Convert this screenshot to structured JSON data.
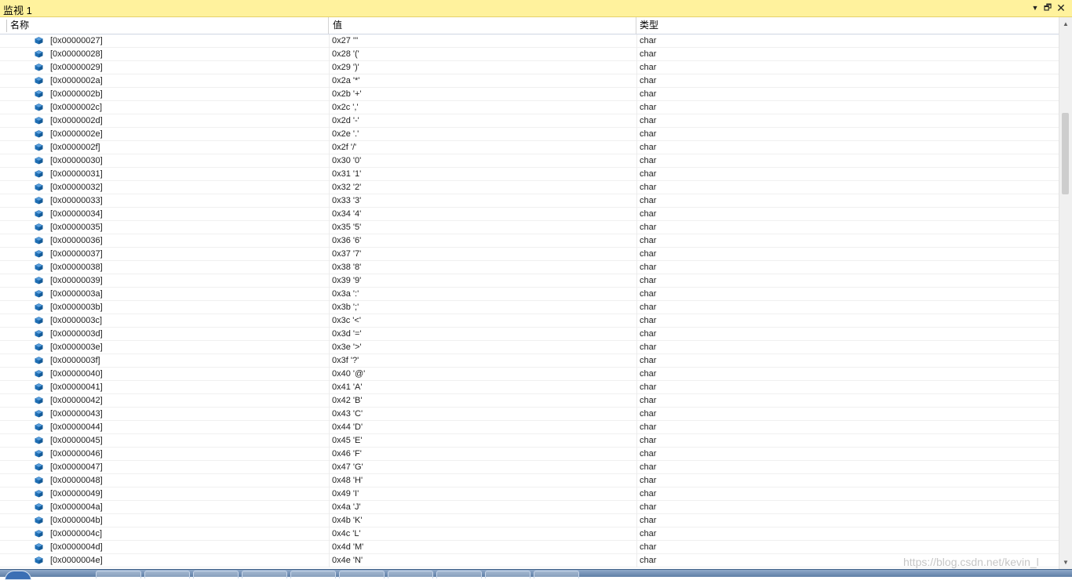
{
  "window": {
    "title": "监视 1",
    "dropdown_icon": "triangle-down-icon",
    "restore_icon": "restore-icon",
    "close_icon": "close-icon"
  },
  "header": {
    "col_name": "名称",
    "col_value": "值",
    "col_type": "类型"
  },
  "icon_color": "#1f6fb5",
  "rows": [
    {
      "name": "[0x00000027]",
      "value": "0x27 '''",
      "type": "char"
    },
    {
      "name": "[0x00000028]",
      "value": "0x28 '('",
      "type": "char"
    },
    {
      "name": "[0x00000029]",
      "value": "0x29 ')'",
      "type": "char"
    },
    {
      "name": "[0x0000002a]",
      "value": "0x2a '*'",
      "type": "char"
    },
    {
      "name": "[0x0000002b]",
      "value": "0x2b '+'",
      "type": "char"
    },
    {
      "name": "[0x0000002c]",
      "value": "0x2c ','",
      "type": "char"
    },
    {
      "name": "[0x0000002d]",
      "value": "0x2d '-'",
      "type": "char"
    },
    {
      "name": "[0x0000002e]",
      "value": "0x2e '.'",
      "type": "char"
    },
    {
      "name": "[0x0000002f]",
      "value": "0x2f '/'",
      "type": "char"
    },
    {
      "name": "[0x00000030]",
      "value": "0x30 '0'",
      "type": "char"
    },
    {
      "name": "[0x00000031]",
      "value": "0x31 '1'",
      "type": "char"
    },
    {
      "name": "[0x00000032]",
      "value": "0x32 '2'",
      "type": "char"
    },
    {
      "name": "[0x00000033]",
      "value": "0x33 '3'",
      "type": "char"
    },
    {
      "name": "[0x00000034]",
      "value": "0x34 '4'",
      "type": "char"
    },
    {
      "name": "[0x00000035]",
      "value": "0x35 '5'",
      "type": "char"
    },
    {
      "name": "[0x00000036]",
      "value": "0x36 '6'",
      "type": "char"
    },
    {
      "name": "[0x00000037]",
      "value": "0x37 '7'",
      "type": "char"
    },
    {
      "name": "[0x00000038]",
      "value": "0x38 '8'",
      "type": "char"
    },
    {
      "name": "[0x00000039]",
      "value": "0x39 '9'",
      "type": "char"
    },
    {
      "name": "[0x0000003a]",
      "value": "0x3a ':'",
      "type": "char"
    },
    {
      "name": "[0x0000003b]",
      "value": "0x3b ';'",
      "type": "char"
    },
    {
      "name": "[0x0000003c]",
      "value": "0x3c '<'",
      "type": "char"
    },
    {
      "name": "[0x0000003d]",
      "value": "0x3d '='",
      "type": "char"
    },
    {
      "name": "[0x0000003e]",
      "value": "0x3e '>'",
      "type": "char"
    },
    {
      "name": "[0x0000003f]",
      "value": "0x3f '?'",
      "type": "char"
    },
    {
      "name": "[0x00000040]",
      "value": "0x40 '@'",
      "type": "char"
    },
    {
      "name": "[0x00000041]",
      "value": "0x41 'A'",
      "type": "char"
    },
    {
      "name": "[0x00000042]",
      "value": "0x42 'B'",
      "type": "char"
    },
    {
      "name": "[0x00000043]",
      "value": "0x43 'C'",
      "type": "char"
    },
    {
      "name": "[0x00000044]",
      "value": "0x44 'D'",
      "type": "char"
    },
    {
      "name": "[0x00000045]",
      "value": "0x45 'E'",
      "type": "char"
    },
    {
      "name": "[0x00000046]",
      "value": "0x46 'F'",
      "type": "char"
    },
    {
      "name": "[0x00000047]",
      "value": "0x47 'G'",
      "type": "char"
    },
    {
      "name": "[0x00000048]",
      "value": "0x48 'H'",
      "type": "char"
    },
    {
      "name": "[0x00000049]",
      "value": "0x49 'I'",
      "type": "char"
    },
    {
      "name": "[0x0000004a]",
      "value": "0x4a 'J'",
      "type": "char"
    },
    {
      "name": "[0x0000004b]",
      "value": "0x4b 'K'",
      "type": "char"
    },
    {
      "name": "[0x0000004c]",
      "value": "0x4c 'L'",
      "type": "char"
    },
    {
      "name": "[0x0000004d]",
      "value": "0x4d 'M'",
      "type": "char"
    },
    {
      "name": "[0x0000004e]",
      "value": "0x4e 'N'",
      "type": "char"
    }
  ],
  "watermark": "https://blog.csdn.net/kevin_l"
}
